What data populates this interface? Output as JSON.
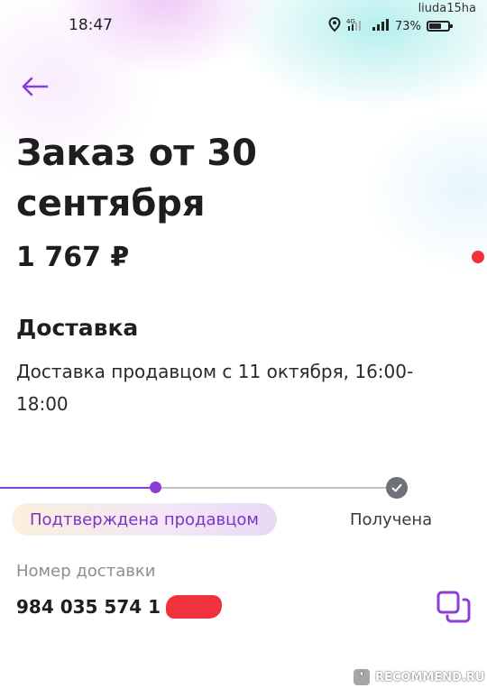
{
  "status_bar": {
    "time": "18:47",
    "battery": "73%",
    "battery_level": 0.73,
    "icons": [
      "location-icon",
      "network-4g-icon",
      "signal-icon",
      "battery-icon"
    ]
  },
  "watermark_user": "liuda15ha",
  "header": {
    "back_icon": "arrow-left-icon",
    "title": "Заказ от 30 сентября",
    "total": "1 767 ₽"
  },
  "delivery": {
    "section_title": "Доставка",
    "text": "Доставка продавцом с 11 октября, 16:00-18:00"
  },
  "progress": {
    "steps": [
      {
        "label": "Подтверждена продавцом",
        "state": "current"
      },
      {
        "label": "Получена",
        "state": "pending"
      }
    ]
  },
  "tracking": {
    "label": "Номер доставки",
    "number_visible": "984 035 574 1",
    "copy_icon": "copy-icon"
  },
  "watermark": "RECOMMEND.RU",
  "colors": {
    "accent": "#8a3fd6",
    "alert_dot": "#f0303a",
    "text": "#1e1e1e",
    "muted": "#8d8d93"
  }
}
